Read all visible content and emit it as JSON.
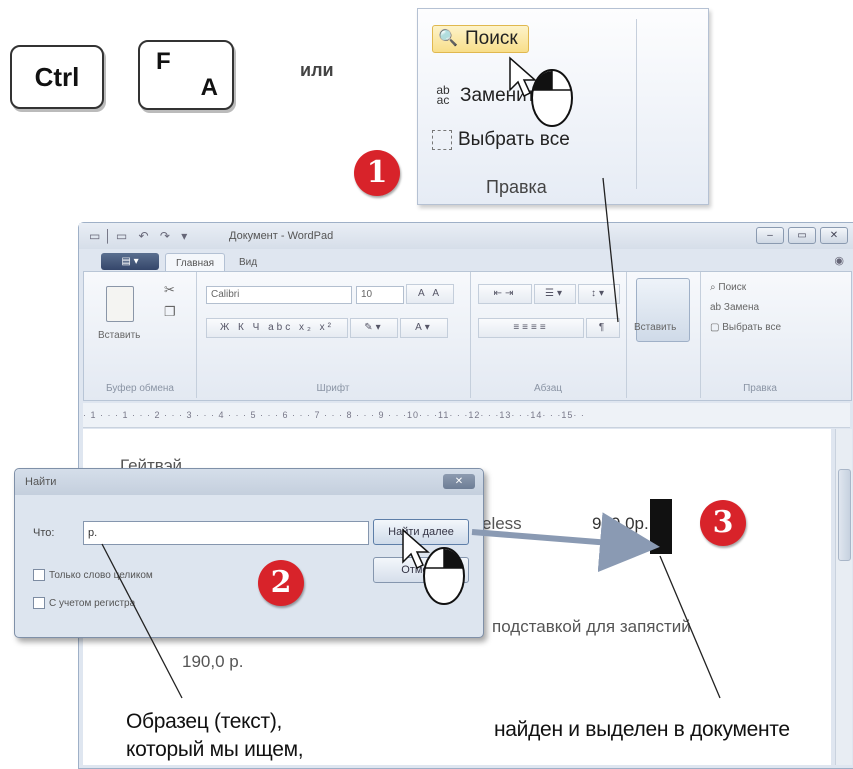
{
  "keys": {
    "ctrl": "Ctrl",
    "f_top": "F",
    "f_bottom": "A",
    "or": "или"
  },
  "badges": [
    "1",
    "2",
    "3"
  ],
  "edit_panel": {
    "search": "Поиск",
    "replace": "Заменить",
    "select_all": "Выбрать все",
    "group": "Правка"
  },
  "wordpad": {
    "title": "Документ - WordPad",
    "tabs": [
      "Главная",
      "Вид"
    ],
    "groups": {
      "clipboard": "Буфер обмена",
      "font": "Шрифт",
      "paragraph": "Абзац",
      "edit": "Правка"
    },
    "paste": "Вставить",
    "font_name": "Calibri",
    "font_size": "10",
    "insert_object": "Вставить",
    "edit_items": [
      "Поиск",
      "Замена",
      "Выбрать все"
    ],
    "ruler": "· 1 · · · 1 · · · 2 · · · 3 · · · 4 · · · 5 · · · 6 · · · 7 · · · 8 · · · 9 · · ·10· · ·11· · ·12· · ·13· · ·14· · ·15· ·",
    "doc_lines": {
      "line1": "Гейтвэй",
      "line2_tail": "eless",
      "price1": "990,0р.",
      "line3_tail": "подставкой для запястий",
      "price2": "190,0 р."
    }
  },
  "find_dialog": {
    "title": "Найти",
    "what_label": "Что:",
    "what_value": "р.",
    "find_next": "Найти далее",
    "cancel": "Отмена",
    "whole_word": "Только слово целиком",
    "match_case": "С учетом регистра"
  },
  "captions": {
    "sample_line1": "Образец (текст),",
    "sample_line2": "который мы ищем,",
    "found": "найден и выделен в документе"
  }
}
